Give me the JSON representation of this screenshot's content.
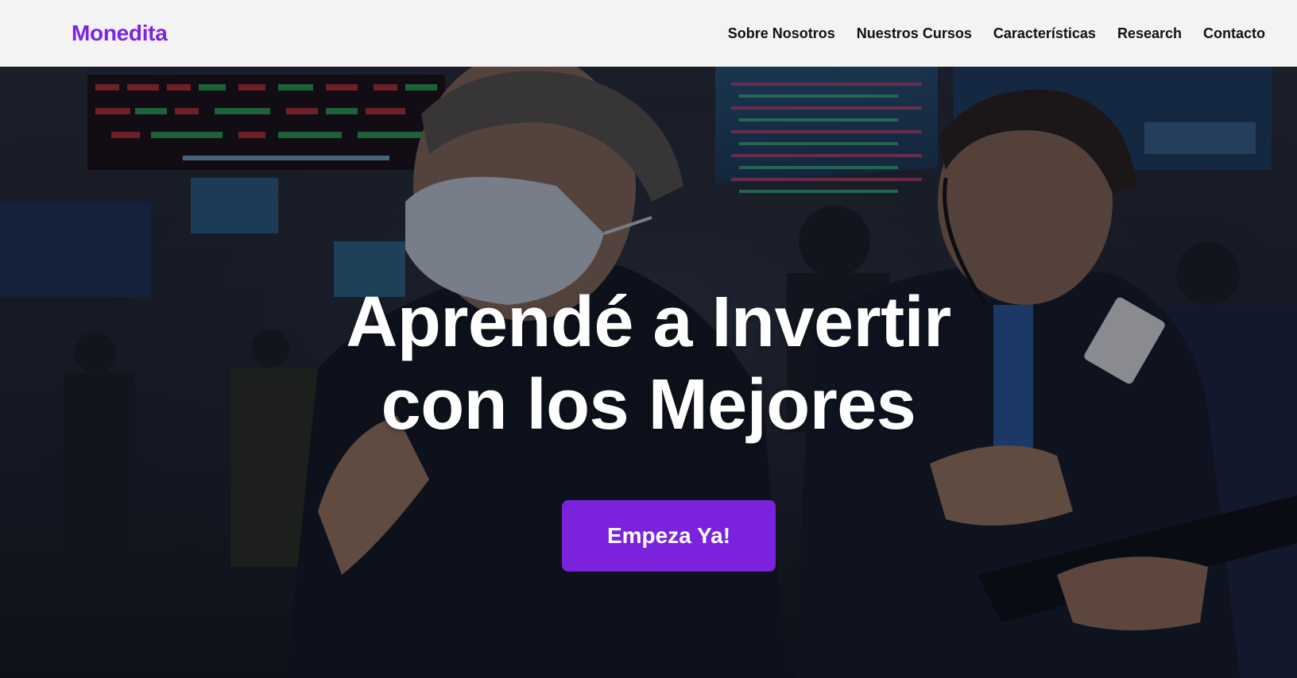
{
  "header": {
    "logo": "Monedita",
    "nav": [
      {
        "label": "Sobre Nosotros"
      },
      {
        "label": "Nuestros Cursos"
      },
      {
        "label": "Características"
      },
      {
        "label": "Research"
      },
      {
        "label": "Contacto"
      }
    ]
  },
  "hero": {
    "title_line1": "Aprendé a Invertir",
    "title_line2": "con los Mejores",
    "cta_label": "Empeza Ya!",
    "background_image": "stock-exchange-traders-photo"
  },
  "colors": {
    "brand": "#7c24e0",
    "button": "#7a22dc",
    "navbar_bg": "#f3f3f3",
    "nav_text": "#111111",
    "hero_text": "#ffffff"
  }
}
